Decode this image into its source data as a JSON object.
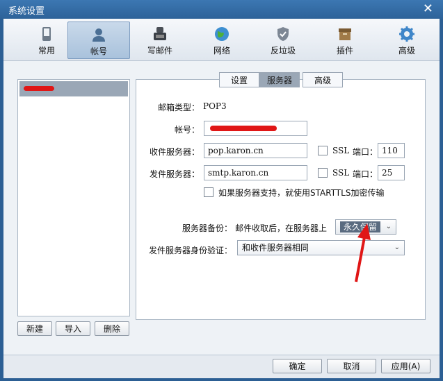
{
  "window": {
    "title": "系统设置",
    "close_glyph": "✕"
  },
  "toolbar": {
    "items": [
      {
        "label": "常用",
        "icon": "phone-icon"
      },
      {
        "label": "帐号",
        "icon": "user-icon"
      },
      {
        "label": "写邮件",
        "icon": "compose-icon"
      },
      {
        "label": "网络",
        "icon": "globe-icon"
      },
      {
        "label": "反垃圾",
        "icon": "shield-icon"
      },
      {
        "label": "插件",
        "icon": "box-icon"
      },
      {
        "label": "高级",
        "icon": "gear-icon"
      }
    ],
    "active_index": 1
  },
  "account_list": {
    "buttons": {
      "new": "新建",
      "import": "导入",
      "delete": "删除"
    }
  },
  "tabs": [
    "设置",
    "服务器",
    "高级"
  ],
  "active_tab": 1,
  "form": {
    "mailbox_type_label": "邮箱类型：",
    "mailbox_type_value": "POP3",
    "account_label": "帐号：",
    "incoming_label": "收件服务器：",
    "incoming_value": "pop.karon.cn",
    "incoming_ssl": "SSL",
    "incoming_port_label": "端口：",
    "incoming_port": "110",
    "outgoing_label": "发件服务器：",
    "outgoing_value": "smtp.karon.cn",
    "outgoing_ssl": "SSL",
    "outgoing_port_label": "端口：",
    "outgoing_port": "25",
    "starttls_label": "如果服务器支持，就使用STARTTLS加密传输",
    "backup_label": "服务器备份：",
    "backup_desc": "邮件收取后，在服务器上",
    "backup_value": "永久保留",
    "auth_label": "发件服务器身份验证：",
    "auth_value": "和收件服务器相同"
  },
  "footer": {
    "ok": "确定",
    "cancel": "取消",
    "apply": "应用(A)"
  },
  "colors": {
    "annotation_red": "#e01616",
    "title_bar": "#2d6299"
  }
}
